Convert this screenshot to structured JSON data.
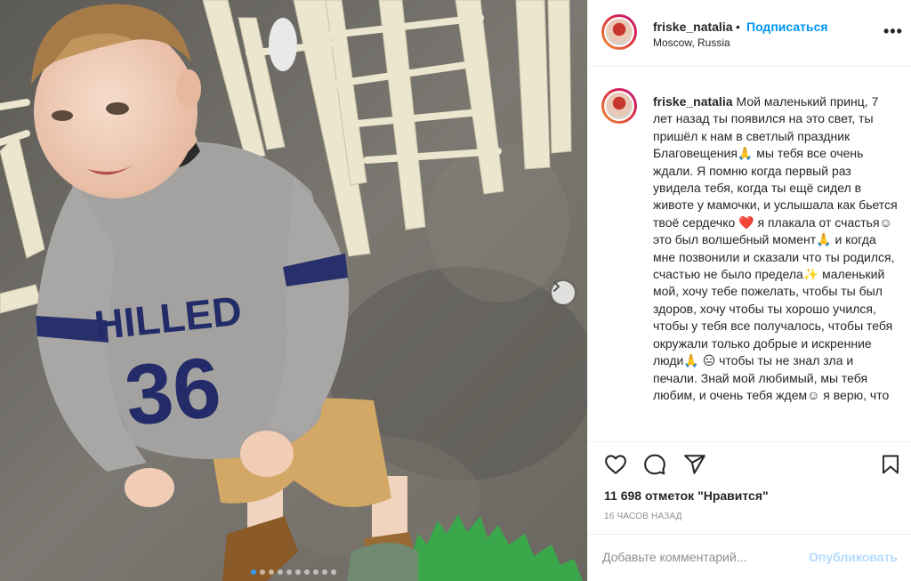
{
  "post": {
    "username": "friske_natalia",
    "separator": "•",
    "follow_label": "Подписаться",
    "location": "Moscow, Russia",
    "more_label": "•••"
  },
  "photo": {
    "jersey_text": "HILLED",
    "jersey_number": "36",
    "dots_count": 10,
    "active_dot": 0
  },
  "caption": {
    "username": "friske_natalia",
    "segments": [
      "Мой маленький принц, 7 лет назад ты появился на это свет, ты пришёл к нам в светлый праздник Благовещения",
      " мы тебя все очень ждали. Я помню когда первый раз увидела тебя, когда ты ещё сидел в животе у мамочки, и услышала как бьется твоё сердечко ",
      " я плакала от счастья",
      " это был волшебный момент",
      " и когда мне позвонили и сказали что ты родился, счастью не было предела",
      " маленький мой, хочу тебе пожелать, чтобы ты был здоров, хочу чтобы ты хорошо учился, чтобы у тебя все получалось, чтобы тебя окружали только добрые и искренние люди",
      " ",
      " чтобы ты не знал зла и печали. Знай мой любимый, мы тебя любим, и очень тебя ждем",
      " я верю, что"
    ],
    "emojis": [
      "🙏",
      "❤️",
      "☺",
      "🙏",
      "✨",
      "🙏",
      "😑",
      "☺"
    ]
  },
  "actions": {
    "likes_text": "11 698 отметок \"Нравится\"",
    "time_text": "16 ЧАСОВ НАЗАД"
  },
  "comment": {
    "placeholder": "Добавьте комментарий...",
    "publish_label": "Опубликовать"
  },
  "colors": {
    "link_blue": "#0095f6",
    "publish_disabled": "#b3dbff",
    "text": "#262626",
    "muted": "#8e8e8e"
  },
  "icons": [
    "heart-icon",
    "comment-icon",
    "share-icon",
    "bookmark-icon",
    "chevron-right-icon",
    "more-icon"
  ]
}
